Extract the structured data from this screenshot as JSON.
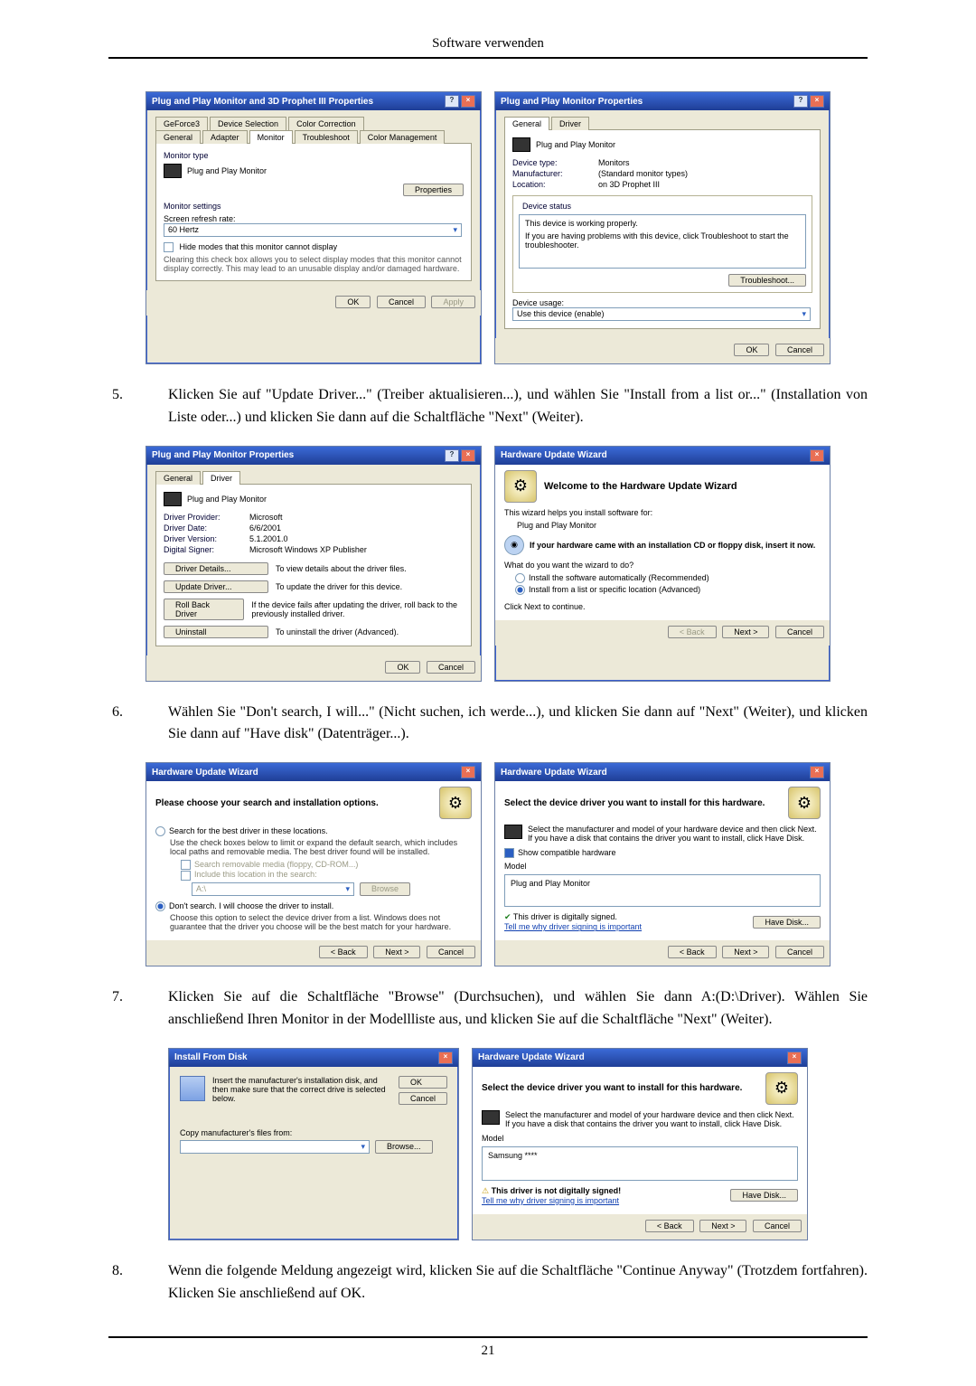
{
  "header": "Software verwenden",
  "page_number": "21",
  "step5": {
    "num": "5.",
    "text": "Klicken Sie auf \"Update Driver...\" (Treiber aktualisieren...), und wählen Sie \"Install from a list or...\" (Installation von Liste oder...) und klicken Sie dann auf die Schaltfläche \"Next\" (Weiter)."
  },
  "step6": {
    "num": "6.",
    "text": "Wählen Sie \"Don't search, I will...\" (Nicht suchen, ich werde...), und klicken Sie dann auf \"Next\" (Weiter), und klicken Sie dann auf \"Have disk\" (Datenträger...)."
  },
  "step7": {
    "num": "7.",
    "text": "Klicken Sie auf die Schaltfläche \"Browse\" (Durchsuchen), und wählen Sie dann A:(D:\\Driver). Wählen Sie anschließend Ihren Monitor in der Modellliste aus, und klicken Sie auf die Schaltfläche \"Next\" (Weiter)."
  },
  "step8": {
    "num": "8.",
    "text": "Wenn die folgende Meldung angezeigt wird, klicken Sie auf die Schaltfläche \"Continue Anyway\" (Trotzdem fortfahren). Klicken Sie anschließend auf OK."
  },
  "dlgA": {
    "title": "Plug and Play Monitor and 3D Prophet III Properties",
    "tabs_top": [
      "GeForce3",
      "Device Selection",
      "Color Correction"
    ],
    "tabs_bot": [
      "General",
      "Adapter",
      "Monitor",
      "Troubleshoot",
      "Color Management"
    ],
    "monitor_type_label": "Monitor type",
    "monitor_type_value": "Plug and Play Monitor",
    "properties_btn": "Properties",
    "settings_label": "Monitor settings",
    "refresh_label": "Screen refresh rate:",
    "refresh_value": "60 Hertz",
    "hide_modes": "Hide modes that this monitor cannot display",
    "hide_modes_desc": "Clearing this check box allows you to select display modes that this monitor cannot display correctly. This may lead to an unusable display and/or damaged hardware.",
    "ok": "OK",
    "cancel": "Cancel",
    "apply": "Apply"
  },
  "dlgB": {
    "title": "Plug and Play Monitor Properties",
    "tabs": [
      "General",
      "Driver"
    ],
    "name": "Plug and Play Monitor",
    "rows": {
      "Device type:": "Monitors",
      "Manufacturer:": "(Standard monitor types)",
      "Location:": "on 3D Prophet III"
    },
    "status_label": "Device status",
    "status_text": "This device is working properly.",
    "status_help": "If you are having problems with this device, click Troubleshoot to start the troubleshooter.",
    "troubleshoot": "Troubleshoot...",
    "usage_label": "Device usage:",
    "usage_value": "Use this device (enable)",
    "ok": "OK",
    "cancel": "Cancel"
  },
  "dlgC": {
    "title": "Plug and Play Monitor Properties",
    "tabs": [
      "General",
      "Driver"
    ],
    "name": "Plug and Play Monitor",
    "rows": {
      "Driver Provider:": "Microsoft",
      "Driver Date:": "6/6/2001",
      "Driver Version:": "5.1.2001.0",
      "Digital Signer:": "Microsoft Windows XP Publisher"
    },
    "details_btn": "Driver Details...",
    "details_txt": "To view details about the driver files.",
    "update_btn": "Update Driver...",
    "update_txt": "To update the driver for this device.",
    "rollback_btn": "Roll Back Driver",
    "rollback_txt": "If the device fails after updating the driver, roll back to the previously installed driver.",
    "uninstall_btn": "Uninstall",
    "uninstall_txt": "To uninstall the driver (Advanced).",
    "ok": "OK",
    "cancel": "Cancel"
  },
  "dlgD": {
    "title": "Hardware Update Wizard",
    "heading": "Welcome to the Hardware Update Wizard",
    "line1": "This wizard helps you install software for:",
    "device": "Plug and Play Monitor",
    "cd_hint": "If your hardware came with an installation CD or floppy disk, insert it now.",
    "question": "What do you want the wizard to do?",
    "opt1": "Install the software automatically (Recommended)",
    "opt2": "Install from a list or specific location (Advanced)",
    "continue": "Click Next to continue.",
    "back": "< Back",
    "next": "Next >",
    "cancel": "Cancel"
  },
  "dlgE": {
    "title": "Hardware Update Wizard",
    "heading": "Please choose your search and installation options.",
    "opt1": "Search for the best driver in these locations.",
    "opt1_desc": "Use the check boxes below to limit or expand the default search, which includes local paths and removable media. The best driver found will be installed.",
    "chk1": "Search removable media (floppy, CD-ROM...)",
    "chk2": "Include this location in the search:",
    "path": "A:\\",
    "browse": "Browse",
    "opt2": "Don't search. I will choose the driver to install.",
    "opt2_desc": "Choose this option to select the device driver from a list. Windows does not guarantee that the driver you choose will be the best match for your hardware.",
    "back": "< Back",
    "next": "Next >",
    "cancel": "Cancel"
  },
  "dlgF": {
    "title": "Hardware Update Wizard",
    "heading": "Select the device driver you want to install for this hardware.",
    "desc": "Select the manufacturer and model of your hardware device and then click Next. If you have a disk that contains the driver you want to install, click Have Disk.",
    "show_compat": "Show compatible hardware",
    "model_label": "Model",
    "model_value": "Plug and Play Monitor",
    "signed": "This driver is digitally signed.",
    "tell_me": "Tell me why driver signing is important",
    "have_disk": "Have Disk...",
    "back": "< Back",
    "next": "Next >",
    "cancel": "Cancel"
  },
  "dlgG": {
    "title": "Install From Disk",
    "desc": "Insert the manufacturer's installation disk, and then make sure that the correct drive is selected below.",
    "ok": "OK",
    "cancel": "Cancel",
    "copy_label": "Copy manufacturer's files from:",
    "path": "",
    "browse": "Browse..."
  },
  "dlgH": {
    "title": "Hardware Update Wizard",
    "heading": "Select the device driver you want to install for this hardware.",
    "desc": "Select the manufacturer and model of your hardware device and then click Next. If you have a disk that contains the driver you want to install, click Have Disk.",
    "model_label": "Model",
    "model_value": "Samsung ****",
    "not_signed": "This driver is not digitally signed!",
    "tell_me": "Tell me why driver signing is important",
    "have_disk": "Have Disk...",
    "back": "< Back",
    "next": "Next >",
    "cancel": "Cancel"
  }
}
